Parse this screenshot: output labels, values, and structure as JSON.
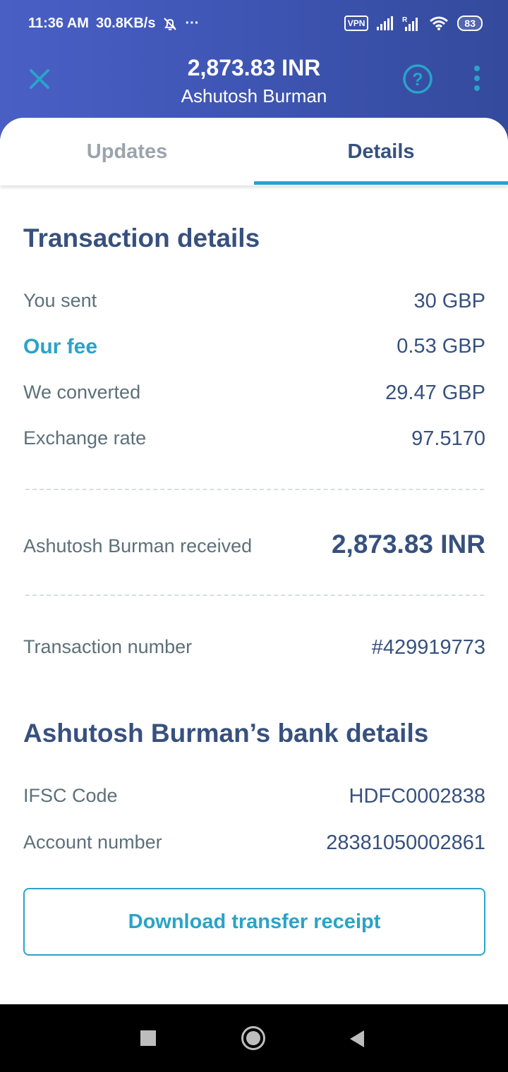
{
  "status_bar": {
    "time": "11:36 AM",
    "speed": "30.8KB/s",
    "more": "···",
    "vpn": "VPN",
    "battery": "83"
  },
  "header": {
    "amount": "2,873.83 INR",
    "recipient": "Ashutosh Burman",
    "close_icon": "close-icon",
    "help_icon": "help-icon",
    "more_icon": "more-vertical-icon"
  },
  "tabs": [
    {
      "label": "Updates",
      "selected": false
    },
    {
      "label": "Details",
      "selected": true
    }
  ],
  "transaction": {
    "title": "Transaction details",
    "rows": [
      {
        "label": "You sent",
        "value": "30 GBP"
      },
      {
        "label": "Our fee",
        "value": "0.53 GBP"
      },
      {
        "label": "We converted",
        "value": "29.47 GBP"
      },
      {
        "label": "Exchange rate",
        "value": "97.5170"
      }
    ],
    "received_label": "Ashutosh Burman received",
    "received_value": "2,873.83 INR",
    "number_label": "Transaction number",
    "number_value": "#429919773"
  },
  "bank": {
    "title": "Ashutosh Burman’s bank details",
    "rows": [
      {
        "label": "IFSC Code",
        "value": "HDFC0002838"
      },
      {
        "label": "Account number",
        "value": "28381050002861"
      }
    ]
  },
  "download_button": "Download transfer receipt",
  "colors": {
    "header_bg": "#3f56b5",
    "accent": "#2aa3c9",
    "text_primary": "#37517e",
    "text_secondary": "#5d7079"
  }
}
